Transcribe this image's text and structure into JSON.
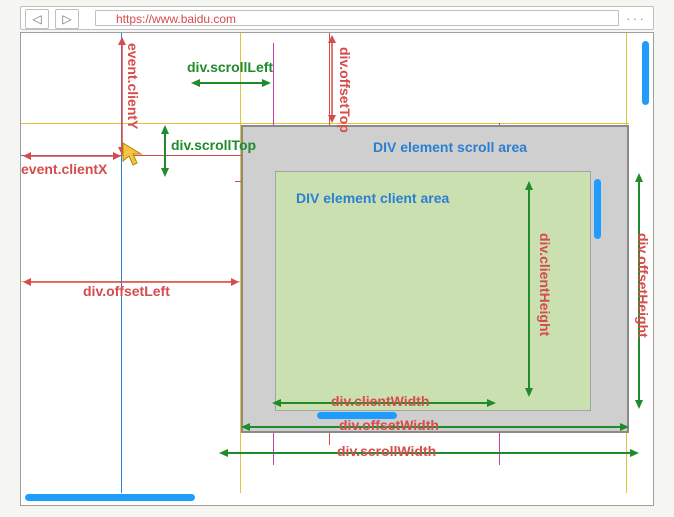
{
  "browser": {
    "url": "https://www.baidu.com",
    "back_icon": "◁",
    "forward_icon": "▷",
    "more_icon": "···"
  },
  "labels": {
    "event_clientX": "event.clientX",
    "event_clientY": "event.clientY",
    "div_scrollLeft": "div.scrollLeft",
    "div_scrollTop": "div.scrollTop",
    "div_offsetTop": "div.offsetTop",
    "div_offsetLeft": "div.offsetLeft",
    "div_scrollWidth": "div.scrollWidth",
    "div_offsetWidth": "div.offsetWidth",
    "div_clientWidth": "div.clientWidth",
    "div_clientHeight": "div.clientHeight",
    "div_offsetHeight": "div.offsetHeight",
    "scroll_area_title": "DIV element scroll area",
    "client_area_title": "DIV element client area"
  },
  "colors": {
    "label_red": "#d64b4b",
    "label_green": "#1f8b2b",
    "label_blue": "#2a7fd3",
    "scroll_blue": "#1f9dff",
    "scroll_area_fill": "#cfcfcf",
    "client_area_fill": "#cbe0b0"
  },
  "geometry_note": "Diagram illustrating DOM element box-model measurement properties (scroll/offset/client) relative to a viewport and a mouse event's clientX/clientY."
}
